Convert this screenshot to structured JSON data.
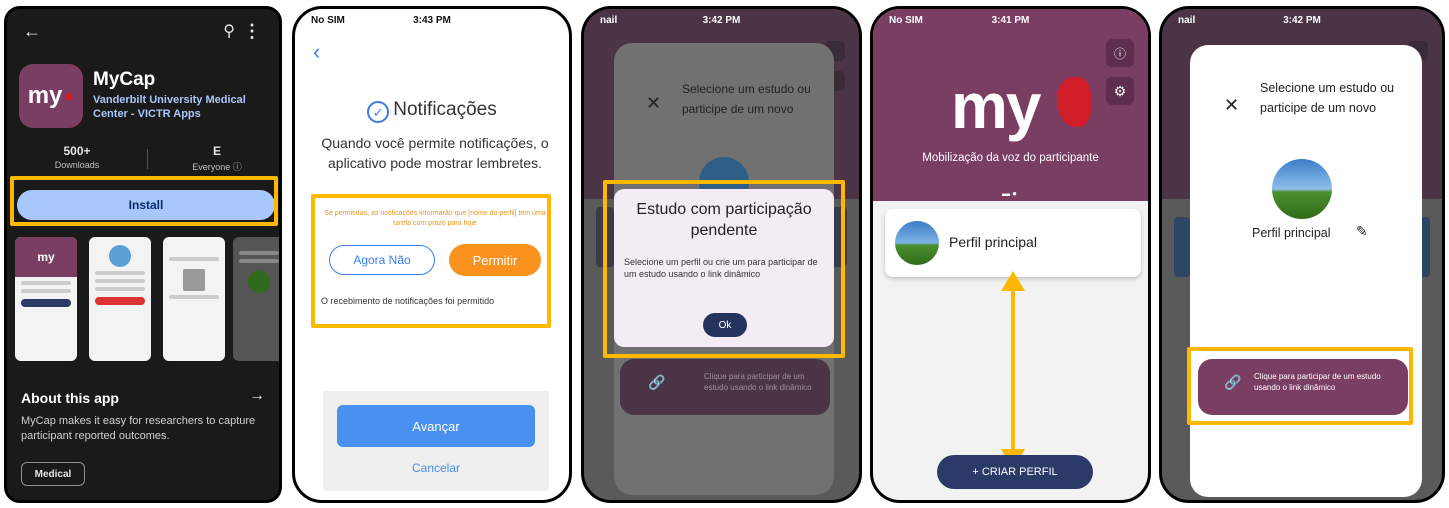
{
  "p1": {
    "app_name": "MyCap",
    "icon_label": "my",
    "developer": "Vanderbilt University Medical Center - VICTR Apps",
    "downloads_value": "500+",
    "downloads_label": "Downloads",
    "rating_value": "E",
    "rating_label": "Everyone ⓘ",
    "install_label": "Install",
    "screenshot_logo": "my",
    "about_title": "About this app",
    "about_arrow": "→",
    "about_text": "MyCap makes it easy for researchers to capture participant reported outcomes.",
    "category_chip": "Medical"
  },
  "p2": {
    "status_left": "No SIM",
    "status_time": "3:43 PM",
    "title": "Notificações",
    "body": "Quando você permite notificações, o aplicativo pode mostrar lembretes.",
    "small_text": "Se permitidas, as notificações informarão que [nome do perfil] tem uma tarefa com prazo para hoje",
    "btn_no": "Agora Não",
    "btn_allow": "Permitir",
    "granted_text": "O recebimento de notificações foi permitido",
    "next_label": "Avançar",
    "cancel_label": "Cancelar"
  },
  "p3": {
    "status_left": "nail",
    "status_time": "3:42 PM",
    "sheet_title": "Selecione um estudo ou participe de um novo",
    "dialog_title": "Estudo com participação pendente",
    "dialog_body": "Selecione um perfil ou crie um para participar de um estudo usando o link dinâmico",
    "dialog_ok": "Ok",
    "join_text": "Clique para participar de um estudo usando o link dinâmico"
  },
  "p4": {
    "status_left": "No SIM",
    "status_time": "3:41 PM",
    "logo_text": "my",
    "tagline": "Mobilização da voz do participante",
    "profile_name": "Perfil principal",
    "create_label": "+ CRIAR PERFIL"
  },
  "p5": {
    "status_left": "nail",
    "status_time": "3:42 PM",
    "sheet_title": "Selecione um estudo ou participe de um novo",
    "profile_name": "Perfil principal",
    "join_text": "Clique para participar de um estudo usando o link dinâmico"
  },
  "colors": {
    "highlight": "#FFB800",
    "brand_purple": "#7a3e63",
    "navy": "#2b3a66",
    "install_blue": "#a8c7fa",
    "allow_orange": "#f9931e"
  }
}
